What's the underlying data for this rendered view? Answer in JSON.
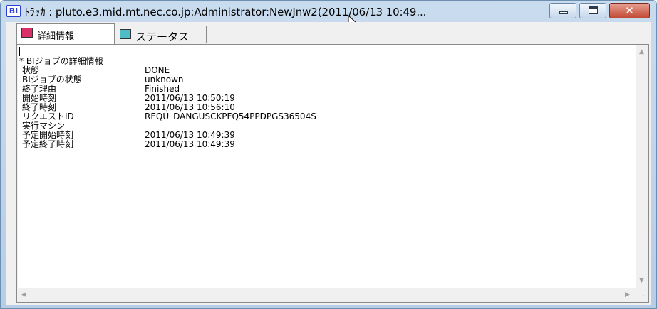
{
  "window": {
    "icon_text": "BI",
    "title": "ﾄﾗｯｶ : pluto.e3.mid.mt.nec.co.jp:Administrator:NewJnw2(2011/06/13 10:49..."
  },
  "tabs": [
    {
      "label": "詳細情報",
      "active": true,
      "icon": "notebook-pink-icon"
    },
    {
      "label": "ステータス",
      "active": false,
      "icon": "notebook-cyan-icon"
    }
  ],
  "details": {
    "heading": "* BIジョブの詳細情報",
    "rows": [
      {
        "label": "状態",
        "value": "DONE"
      },
      {
        "label": "BIジョブの状態",
        "value": "unknown"
      },
      {
        "label": "終了理由",
        "value": "Finished"
      },
      {
        "label": "開始時刻",
        "value": "2011/06/13 10:50:19"
      },
      {
        "label": "終了時刻",
        "value": "2011/06/13 10:56:10"
      },
      {
        "label": "リクエストID",
        "value": "REQU_DANGUSCKPFQ54PPDPGS36504S"
      },
      {
        "label": "実行マシン",
        "value": "-"
      },
      {
        "label": "予定開始時刻",
        "value": "2011/06/13 10:49:39"
      },
      {
        "label": "予定終了時刻",
        "value": "2011/06/13 10:49:39"
      }
    ]
  },
  "controls": {
    "minimize": "minimize-icon",
    "maximize": "maximize-icon",
    "close": "close-icon"
  }
}
